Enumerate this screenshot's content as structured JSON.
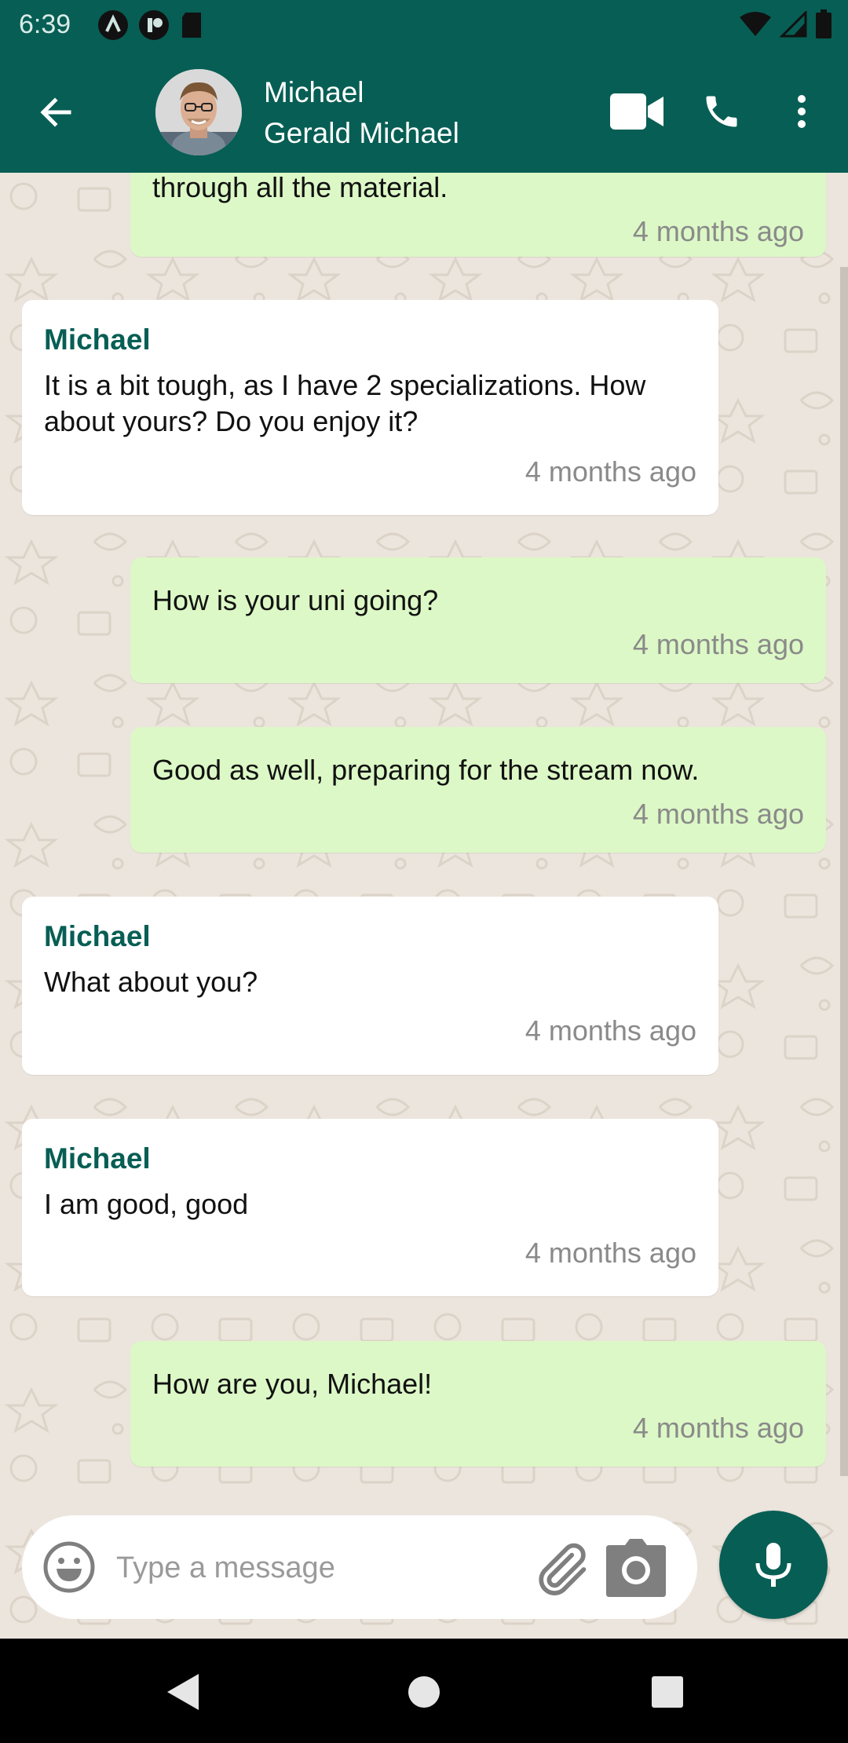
{
  "status_bar": {
    "time": "6:39"
  },
  "header": {
    "back_icon": "arrow-left-icon",
    "contact_name": "Michael",
    "contact_subtitle": "Gerald Michael",
    "actions": [
      "video-call-icon",
      "phone-icon",
      "more-vert-icon"
    ]
  },
  "messages": [
    {
      "direction": "out",
      "text": "through all the material.",
      "time": "4 months ago"
    },
    {
      "direction": "in",
      "sender": "Michael",
      "text": "It is a bit tough, as I have 2 specializations. How about yours? Do you enjoy it?",
      "time": "4 months ago"
    },
    {
      "direction": "out",
      "text": "How is your uni going?",
      "time": "4 months ago"
    },
    {
      "direction": "out",
      "text": "Good as well, preparing for the stream now.",
      "time": "4 months ago"
    },
    {
      "direction": "in",
      "sender": "Michael",
      "text": "What about you?",
      "time": "4 months ago"
    },
    {
      "direction": "in",
      "sender": "Michael",
      "text": "I am good, good",
      "time": "4 months ago"
    },
    {
      "direction": "out",
      "text": "How are you, Michael!",
      "time": "4 months ago"
    }
  ],
  "composer": {
    "placeholder": "Type a message",
    "value": "",
    "emoji_icon": "emoji-icon",
    "attach_icon": "paperclip-icon",
    "camera_icon": "camera-icon",
    "mic_icon": "microphone-icon"
  },
  "colors": {
    "primary": "#075e54",
    "outgoing_bubble": "#dcf8c6",
    "incoming_bubble": "#ffffff",
    "chat_background": "#ece5dd"
  }
}
